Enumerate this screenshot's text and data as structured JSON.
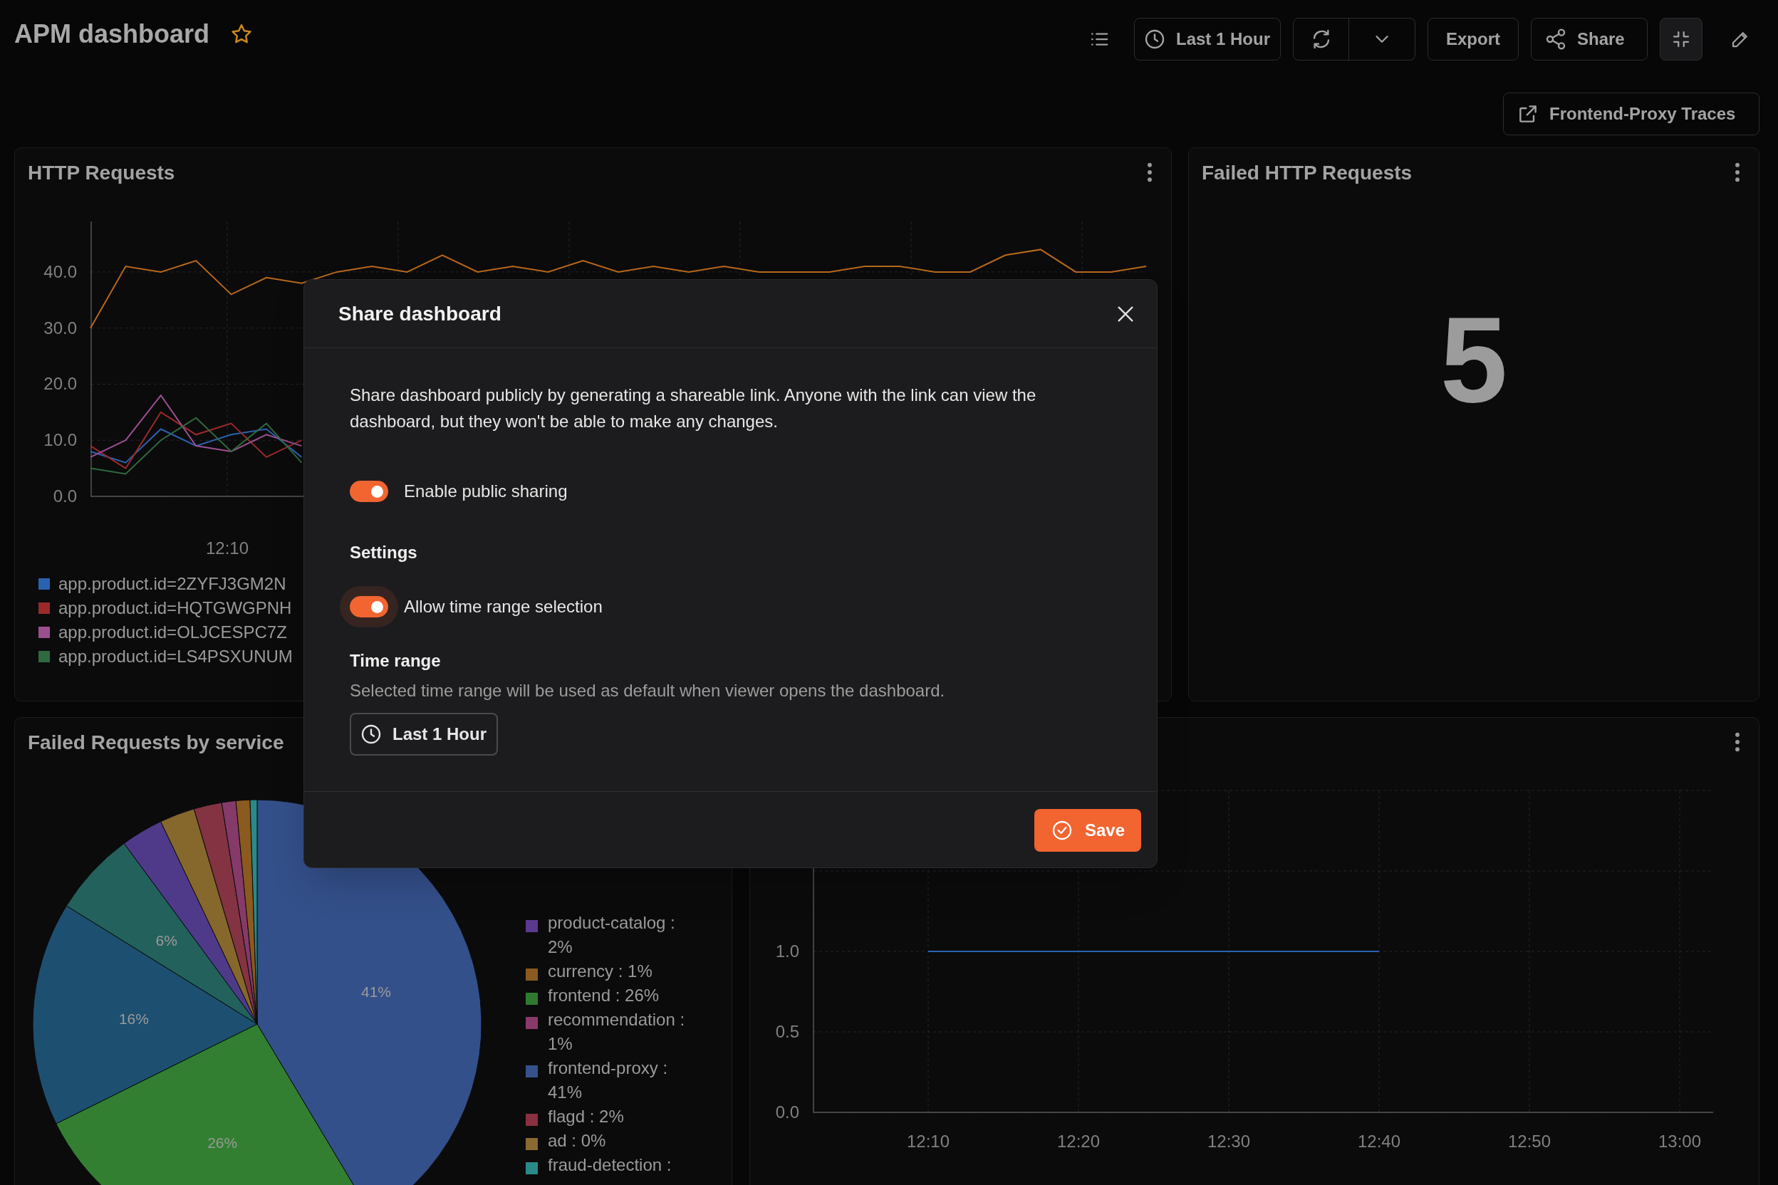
{
  "header": {
    "title": "APM dashboard",
    "starred": false,
    "time_button": "Last 1 Hour",
    "export_button": "Export",
    "share_button": "Share"
  },
  "traces_button": "Frontend-Proxy Traces",
  "http_requests": {
    "title": "HTTP Requests",
    "chart_data": {
      "type": "line",
      "grid": true,
      "ylim": [
        0,
        49
      ],
      "yticks": [
        {
          "value": 0,
          "label": "0.0"
        },
        {
          "value": 10,
          "label": "10.0"
        },
        {
          "value": 20,
          "label": "20.0"
        },
        {
          "value": 30,
          "label": "30.0"
        },
        {
          "value": 40,
          "label": "40.0"
        }
      ],
      "annotations": [
        {
          "text": "12:10"
        }
      ],
      "series": [
        {
          "name": "app.product.id=2ZYFJ3GM2N",
          "color": "#2b62b0",
          "values": [
            8,
            6,
            12,
            9,
            11,
            12,
            7,
            null,
            null,
            null,
            null,
            null,
            null,
            null,
            null,
            null,
            null,
            null,
            null,
            null,
            null,
            null,
            null,
            null,
            null,
            null,
            null,
            null,
            null,
            null,
            null
          ]
        },
        {
          "name": "app.product.id=HQTGWGPNH",
          "color": "#9b2a2a",
          "values": [
            9,
            5,
            15,
            11,
            13,
            7,
            10,
            null,
            null,
            null,
            null,
            null,
            null,
            null,
            null,
            null,
            null,
            null,
            null,
            null,
            null,
            null,
            null,
            null,
            null,
            null,
            null,
            null,
            null,
            null,
            null
          ]
        },
        {
          "name": "app.product.id=OLJCESPC7Z",
          "color": "#9b4f8f",
          "values": [
            7,
            10,
            18,
            9,
            8,
            11,
            9,
            null,
            null,
            null,
            null,
            null,
            null,
            null,
            null,
            null,
            null,
            null,
            null,
            null,
            null,
            null,
            null,
            null,
            null,
            null,
            null,
            null,
            null,
            null,
            null
          ]
        },
        {
          "name": "app.product.id=LS4PSXUNUM",
          "color": "#2f6a3f",
          "values": [
            5,
            4,
            10,
            14,
            8,
            13,
            6,
            null,
            null,
            null,
            null,
            null,
            null,
            null,
            null,
            null,
            null,
            null,
            null,
            null,
            null,
            null,
            null,
            null,
            null,
            null,
            null,
            null,
            null,
            null,
            null
          ]
        },
        {
          "color": "#b8681a",
          "values": [
            30,
            41,
            40,
            42,
            36,
            39,
            38,
            40,
            41,
            40,
            43,
            40,
            41,
            40,
            42,
            40,
            41,
            40,
            41,
            40,
            40,
            40,
            41,
            41,
            40,
            40,
            43,
            44,
            40,
            40,
            41
          ]
        }
      ]
    }
  },
  "failed_http_requests": {
    "title": "Failed HTTP Requests",
    "value": "5"
  },
  "failed_by_service": {
    "title": "Failed Requests by service",
    "chart_data": {
      "type": "pie",
      "values": [
        41,
        26,
        16,
        6,
        3,
        2.5,
        2,
        1,
        1,
        0.5
      ],
      "value_labels": [
        "41%",
        "26%",
        "16%",
        "6%",
        null,
        null,
        null,
        null,
        null,
        null
      ],
      "colors": [
        "#34508a",
        "#327f32",
        "#1d4f70",
        "#23615c",
        "#4f3a8a",
        "#86682c",
        "#843343",
        "#853a6a",
        "#8a5a1f",
        "#2a8a8a"
      ]
    },
    "legend": [
      {
        "label": "product-catalog : 2%",
        "color": "#5a3a90"
      },
      {
        "label": "currency : 1%",
        "color": "#8a5a20"
      },
      {
        "label": "frontend : 26%",
        "color": "#2f7a2f"
      },
      {
        "label": "recommendation : 1%",
        "color": "#8a3a6a"
      },
      {
        "label": "frontend-proxy : 41%",
        "color": "#35528a"
      },
      {
        "label": "flagd : 2%",
        "color": "#8a3040"
      },
      {
        "label": "ad : 0%",
        "color": "#8a6a30"
      },
      {
        "label": "fraud-detection :",
        "color": "#2a8a8a"
      }
    ]
  },
  "panel_4": {
    "chart_data": {
      "type": "line",
      "grid": true,
      "categories": [
        "12:10",
        "12:20",
        "12:30",
        "12:40",
        "12:50",
        "13:00"
      ],
      "ylim": [
        0,
        2
      ],
      "yticks": [
        {
          "value": 0,
          "label": "0.0"
        },
        {
          "value": 0.5,
          "label": "0.5"
        },
        {
          "value": 1,
          "label": "1.0"
        }
      ],
      "series": [
        {
          "color": "#2b62b0",
          "values": [
            1,
            1,
            1,
            1,
            null,
            null
          ]
        }
      ]
    }
  },
  "modal": {
    "title": "Share dashboard",
    "description": "Share dashboard publicly by generating a shareable link. Anyone with the link can view the dashboard, but they won't be able to make any changes.",
    "public_sharing": {
      "label": "Enable public sharing",
      "on": true
    },
    "settings": {
      "heading": "Settings",
      "toggles": [
        {
          "label": "Allow time range selection",
          "on": true,
          "focused": true
        }
      ]
    },
    "time_range": {
      "heading": "Time range",
      "description": "Selected time range will be used as default when viewer opens the dashboard.",
      "button": "Last 1 Hour"
    },
    "save_button": "Save"
  }
}
